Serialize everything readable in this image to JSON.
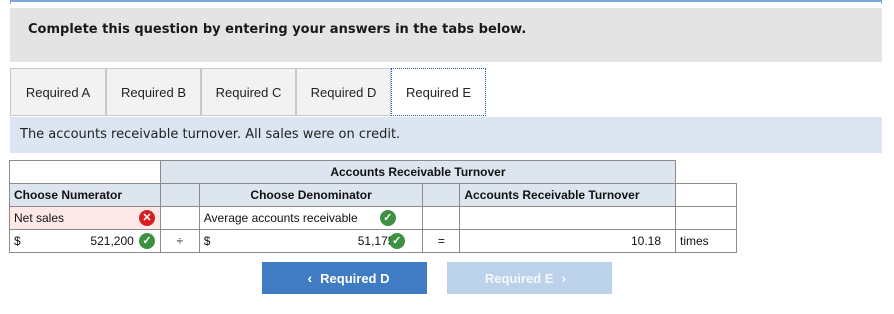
{
  "instruction": "Complete this question by entering your answers in the tabs below.",
  "tabs": [
    {
      "label": "Required A"
    },
    {
      "label": "Required B"
    },
    {
      "label": "Required C"
    },
    {
      "label": "Required D"
    },
    {
      "label": "Required E",
      "active": true
    }
  ],
  "description": "The accounts receivable turnover. All sales were on credit.",
  "table": {
    "title": "Accounts Receivable Turnover",
    "numerator_header": "Choose Numerator",
    "denominator_header": "Choose Denominator",
    "result_header": "Accounts Receivable Turnover",
    "numerator_label": "Net sales",
    "denominator_label": "Average accounts receivable",
    "currency1": "$",
    "numerator_value": "521,200",
    "divide_symbol": "÷",
    "currency2": "$",
    "denominator_value": "51,175",
    "equals_symbol": "=",
    "result_value": "10.18",
    "result_unit": "times"
  },
  "nav": {
    "prev_label": "Required D",
    "next_label": "Required E"
  },
  "icons": {
    "check": "check-circle-icon",
    "error": "x-circle-icon"
  },
  "colors": {
    "correct": "#3d9142",
    "incorrect": "#d42020",
    "primary_button": "#3f7cc3"
  }
}
